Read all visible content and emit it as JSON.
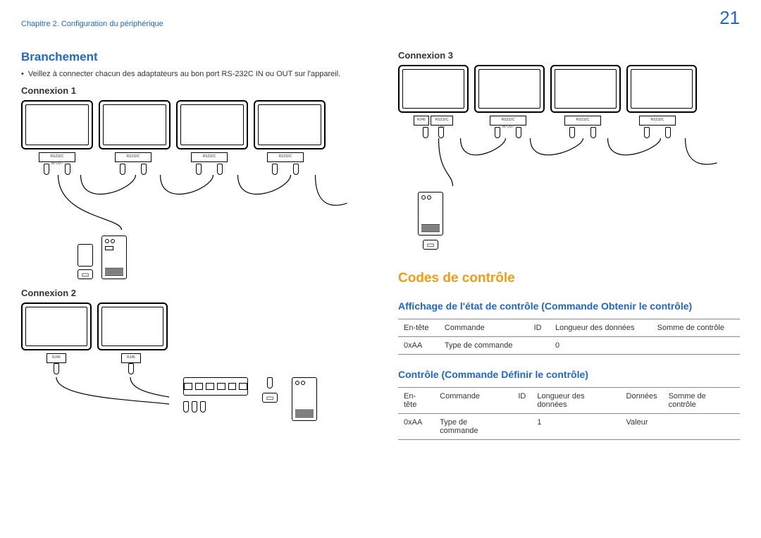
{
  "pageNumber": "21",
  "chapter": "Chapitre 2. Configuration du périphérique",
  "left": {
    "title": "Branchement",
    "bullet": "Veillez à connecter chacun des adaptateurs au bon port RS-232C IN ou OUT sur l'appareil.",
    "conn1": "Connexion 1",
    "conn2": "Connexion 2",
    "portLabelRS": "RS232C",
    "portLabelIO": "IN  OUT",
    "portLabelRJ": "RJ45"
  },
  "right": {
    "conn3": "Connexion 3",
    "portRJ": "RJ45",
    "portRS": "RS232C",
    "portOut": "OUT",
    "portIn": "IN",
    "codesTitle": "Codes de contrôle",
    "sec1": "Affichage de l'état de contrôle (Commande Obtenir le contrôle)",
    "sec2": "Contrôle (Commande Définir le contrôle)",
    "t1": {
      "h": [
        "En-tête",
        "Commande",
        "ID",
        "Longueur des données",
        "Somme de contrôle"
      ],
      "r": [
        "0xAA",
        "Type de commande",
        "",
        "0",
        ""
      ]
    },
    "t2": {
      "h": [
        "En-tête",
        "Commande",
        "ID",
        "Longueur des données",
        "Données",
        "Somme de contrôle"
      ],
      "r": [
        "0xAA",
        "Type de commande",
        "",
        "1",
        "Valeur",
        ""
      ]
    }
  }
}
